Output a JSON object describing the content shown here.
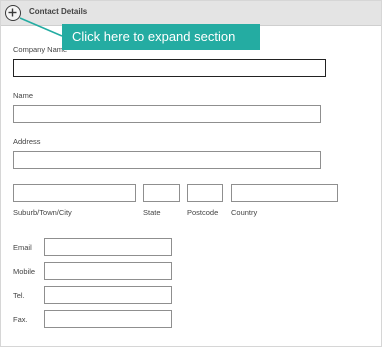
{
  "section": {
    "title": "Contact Details"
  },
  "tooltip": {
    "text": "Click here to expand section"
  },
  "fields": {
    "company_name": {
      "label": "Company Name",
      "value": ""
    },
    "name": {
      "label": "Name",
      "value": ""
    },
    "address": {
      "label": "Address",
      "value": ""
    },
    "suburb": {
      "label": "Suburb/Town/City",
      "value": ""
    },
    "state": {
      "label": "State",
      "value": ""
    },
    "postcode": {
      "label": "Postcode",
      "value": ""
    },
    "country": {
      "label": "Country",
      "value": ""
    },
    "email": {
      "label": "Email",
      "value": ""
    },
    "mobile": {
      "label": "Mobile",
      "value": ""
    },
    "tel": {
      "label": "Tel.",
      "value": ""
    },
    "fax": {
      "label": "Fax.",
      "value": ""
    }
  },
  "colors": {
    "tooltip": "#24aca2",
    "header": "#e4e4e4"
  },
  "icons": {
    "expand": "circle-plus-icon"
  }
}
